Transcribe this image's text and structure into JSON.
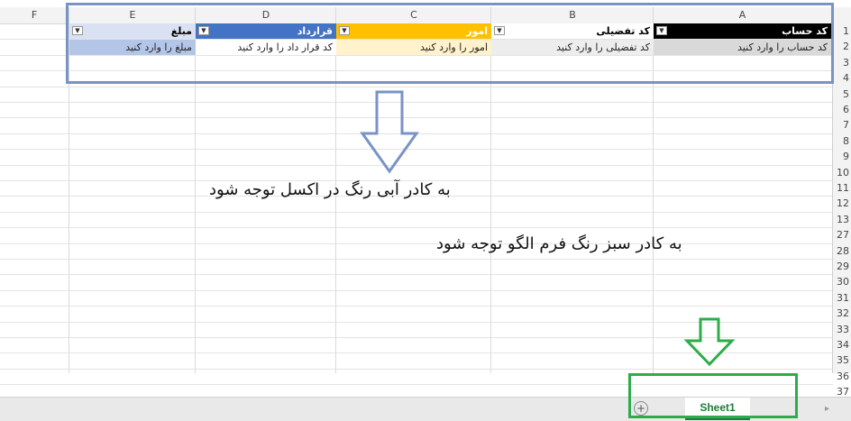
{
  "columns": [
    "F",
    "E",
    "D",
    "C",
    "B",
    "A"
  ],
  "rows": [
    "1",
    "2",
    "3",
    "4",
    "5",
    "6",
    "7",
    "8",
    "9",
    "10",
    "11",
    "12",
    "13",
    "27",
    "28",
    "29",
    "30",
    "31",
    "32",
    "33",
    "34",
    "35",
    "36",
    "37"
  ],
  "headers": {
    "a": "کد حساب",
    "b": "کد تفضیلی",
    "c": "امور",
    "d": "قرارداد",
    "e": "مبلغ"
  },
  "inputs": {
    "a": "کد  حساب را وارد کنید",
    "b": "کد تفضیلی را وارد کنید",
    "c": "امور را وارد کنید",
    "d": "کد قرار داد را وارد کنید",
    "e": "مبلغ را وارد کنید"
  },
  "notes": {
    "blue": "به کادر آبی رنگ در اکسل توجه شود",
    "green": "به کادر سبز رنگ فرم الگو توجه شود"
  },
  "tabs": {
    "sheet1": "Sheet1"
  },
  "colors": {
    "header_a": "#000000",
    "header_b": "#ffffff",
    "header_c": "#ffc000",
    "header_d": "#4472c4",
    "header_e": "#d9e1f2",
    "blue_frame": "#7a93c4",
    "green_frame": "#2eac4a"
  },
  "icons": [
    "dropdown-arrow-icon",
    "down-arrow-icon",
    "add-sheet-icon"
  ]
}
